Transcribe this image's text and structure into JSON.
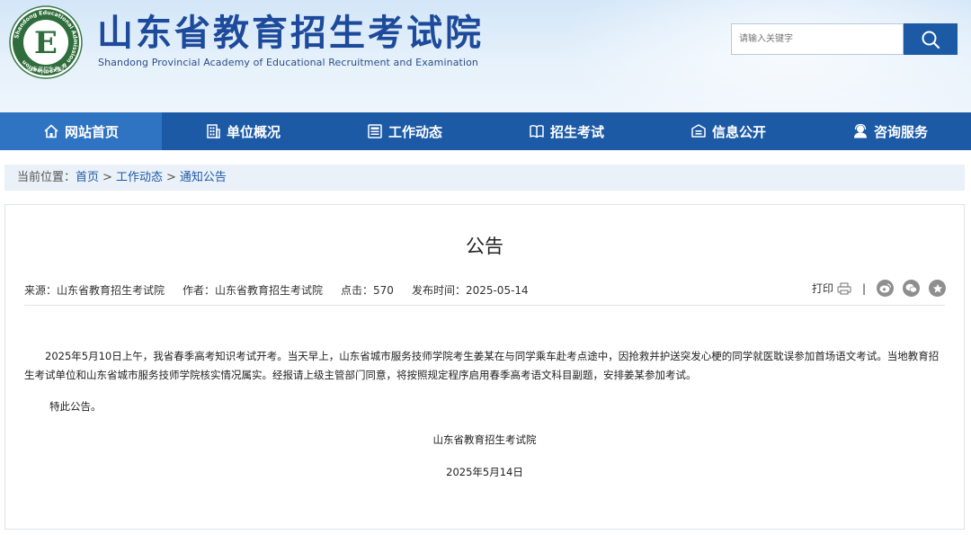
{
  "header": {
    "title": "山东省教育招生考试院",
    "subtitle": "Shandong Provincial Academy of Educational Recruitment and Examination",
    "logo_ring_text": "Shandong Educational Admission & Examination",
    "logo_bottom_text": "山东省招生考试",
    "logo_letter": "E",
    "search_placeholder": "请输入关键字"
  },
  "nav": {
    "items": [
      {
        "label": "网站首页",
        "icon": "home-icon"
      },
      {
        "label": "单位概况",
        "icon": "building-icon"
      },
      {
        "label": "工作动态",
        "icon": "news-icon"
      },
      {
        "label": "招生考试",
        "icon": "book-icon"
      },
      {
        "label": "信息公开",
        "icon": "info-box-icon"
      },
      {
        "label": "咨询服务",
        "icon": "service-icon"
      }
    ]
  },
  "breadcrumb": {
    "prefix": "当前位置：",
    "items": [
      "首页",
      "工作动态",
      "通知公告"
    ],
    "separator": ">"
  },
  "article": {
    "title": "公告",
    "meta": {
      "source": "来源：山东省教育招生考试院",
      "author": "作者：山东省教育招生考试院",
      "clicks": "点击：570",
      "date": "发布时间：2025-05-14"
    },
    "print_label": "打印",
    "tool_separator": "|",
    "paragraphs": [
      "2025年5月10日上午，我省春季高考知识考试开考。当天早上，山东省城市服务技师学院考生姜某在与同学乘车赴考点途中，因抢救并护送突发心梗的同学就医耽误参加首场语文考试。当地教育招生考试单位和山东省城市服务技师学院核实情况属实。经报请上级主管部门同意，将按照规定程序启用春季高考语文科目副题，安排姜某参加考试。"
    ],
    "closing": "特此公告。",
    "signature": "山东省教育招生考试院",
    "sign_date": "2025年5月14日"
  },
  "colors": {
    "brand_blue": "#1c5aa6",
    "nav_active": "#2f74c2",
    "breadcrumb_bg": "#eaf1f9"
  }
}
